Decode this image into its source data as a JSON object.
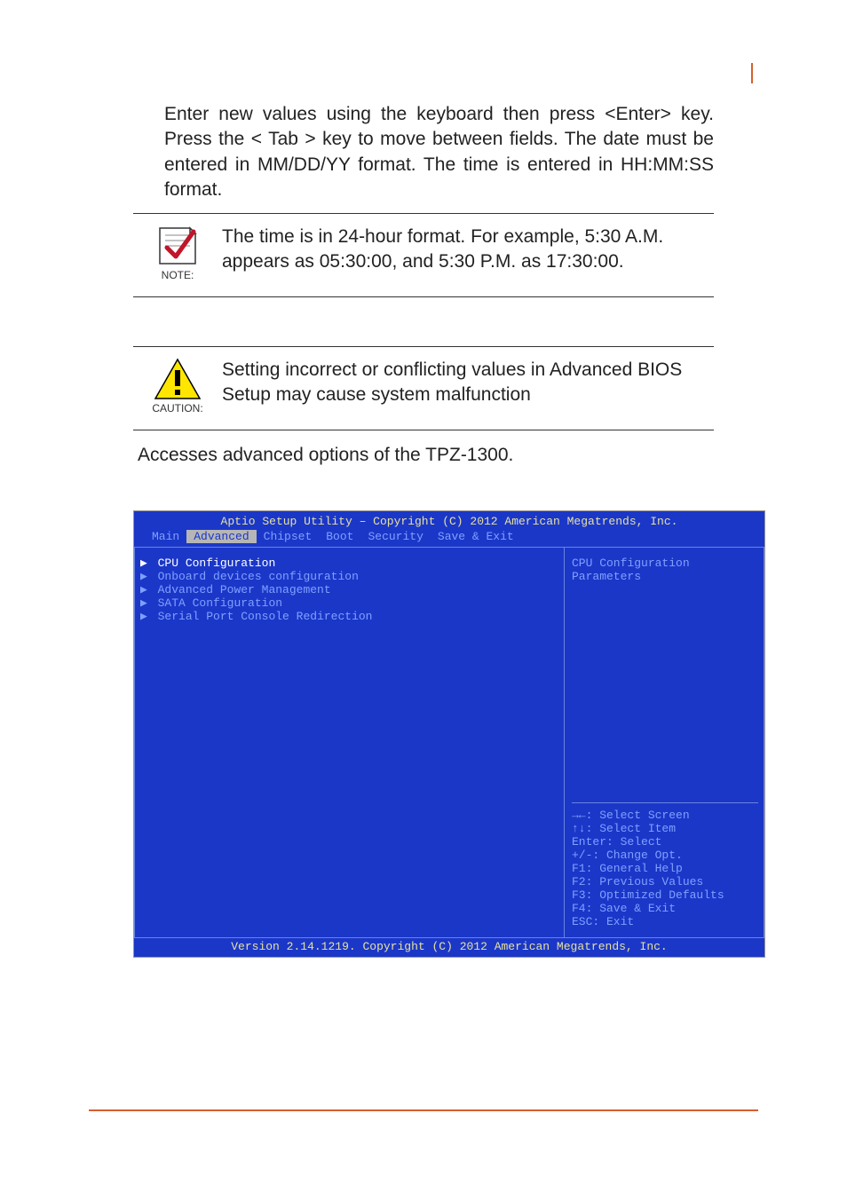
{
  "intro": "Enter new values using the keyboard then press <Enter> key. Press the < Tab > key to move between fields. The date must be entered in MM/DD/YY format. The time is entered in HH:MM:SS format.",
  "note": {
    "caption": "NOTE:",
    "text": "The time is in 24-hour format. For example, 5:30 A.M. appears as 05:30:00, and 5:30 P.M. as 17:30:00."
  },
  "caution": {
    "caption": "CAUTION:",
    "text": "Setting incorrect or conflicting values in Advanced BIOS Setup may cause system malfunction"
  },
  "advanced_line": "Accesses advanced options of the TPZ-1300.",
  "bios": {
    "title": "Aptio Setup Utility – Copyright (C) 2012 American Megatrends, Inc.",
    "tabs": [
      "Main",
      "Advanced",
      "Chipset",
      "Boot",
      "Security",
      "Save & Exit"
    ],
    "active_tab_index": 1,
    "menu_items": [
      "CPU Configuration",
      "Onboard devices configuration",
      "Advanced Power Management",
      "SATA Configuration",
      "Serial Port Console Redirection"
    ],
    "selected_item_index": 0,
    "help_text": "CPU Configuration Parameters",
    "keys": [
      "→←: Select Screen",
      "↑↓: Select Item",
      "Enter: Select",
      "+/-: Change Opt.",
      "F1: General Help",
      "F2: Previous Values",
      "F3: Optimized Defaults",
      "F4: Save & Exit",
      "ESC: Exit"
    ],
    "footer": "Version 2.14.1219. Copyright (C) 2012 American Megatrends, Inc."
  }
}
